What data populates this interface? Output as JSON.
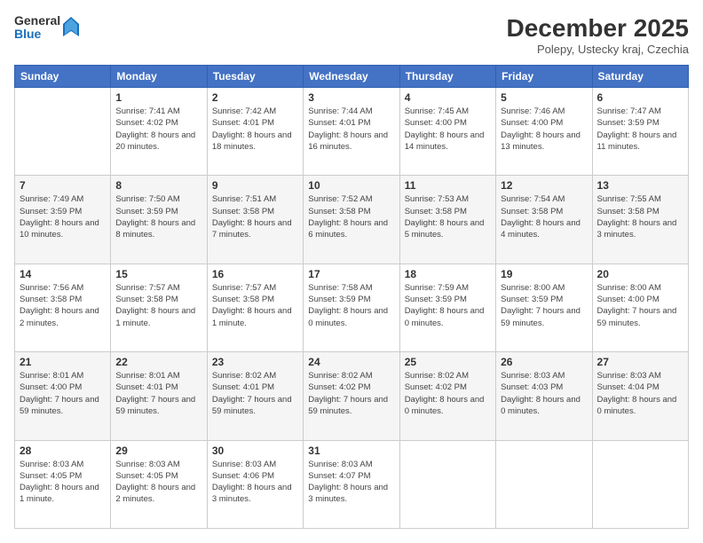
{
  "logo": {
    "general": "General",
    "blue": "Blue"
  },
  "header": {
    "month": "December 2025",
    "location": "Polepy, Ustecky kraj, Czechia"
  },
  "days_of_week": [
    "Sunday",
    "Monday",
    "Tuesday",
    "Wednesday",
    "Thursday",
    "Friday",
    "Saturday"
  ],
  "weeks": [
    [
      {
        "day": "",
        "sunrise": "",
        "sunset": "",
        "daylight": ""
      },
      {
        "day": "1",
        "sunrise": "Sunrise: 7:41 AM",
        "sunset": "Sunset: 4:02 PM",
        "daylight": "Daylight: 8 hours and 20 minutes."
      },
      {
        "day": "2",
        "sunrise": "Sunrise: 7:42 AM",
        "sunset": "Sunset: 4:01 PM",
        "daylight": "Daylight: 8 hours and 18 minutes."
      },
      {
        "day": "3",
        "sunrise": "Sunrise: 7:44 AM",
        "sunset": "Sunset: 4:01 PM",
        "daylight": "Daylight: 8 hours and 16 minutes."
      },
      {
        "day": "4",
        "sunrise": "Sunrise: 7:45 AM",
        "sunset": "Sunset: 4:00 PM",
        "daylight": "Daylight: 8 hours and 14 minutes."
      },
      {
        "day": "5",
        "sunrise": "Sunrise: 7:46 AM",
        "sunset": "Sunset: 4:00 PM",
        "daylight": "Daylight: 8 hours and 13 minutes."
      },
      {
        "day": "6",
        "sunrise": "Sunrise: 7:47 AM",
        "sunset": "Sunset: 3:59 PM",
        "daylight": "Daylight: 8 hours and 11 minutes."
      }
    ],
    [
      {
        "day": "7",
        "sunrise": "Sunrise: 7:49 AM",
        "sunset": "Sunset: 3:59 PM",
        "daylight": "Daylight: 8 hours and 10 minutes."
      },
      {
        "day": "8",
        "sunrise": "Sunrise: 7:50 AM",
        "sunset": "Sunset: 3:59 PM",
        "daylight": "Daylight: 8 hours and 8 minutes."
      },
      {
        "day": "9",
        "sunrise": "Sunrise: 7:51 AM",
        "sunset": "Sunset: 3:58 PM",
        "daylight": "Daylight: 8 hours and 7 minutes."
      },
      {
        "day": "10",
        "sunrise": "Sunrise: 7:52 AM",
        "sunset": "Sunset: 3:58 PM",
        "daylight": "Daylight: 8 hours and 6 minutes."
      },
      {
        "day": "11",
        "sunrise": "Sunrise: 7:53 AM",
        "sunset": "Sunset: 3:58 PM",
        "daylight": "Daylight: 8 hours and 5 minutes."
      },
      {
        "day": "12",
        "sunrise": "Sunrise: 7:54 AM",
        "sunset": "Sunset: 3:58 PM",
        "daylight": "Daylight: 8 hours and 4 minutes."
      },
      {
        "day": "13",
        "sunrise": "Sunrise: 7:55 AM",
        "sunset": "Sunset: 3:58 PM",
        "daylight": "Daylight: 8 hours and 3 minutes."
      }
    ],
    [
      {
        "day": "14",
        "sunrise": "Sunrise: 7:56 AM",
        "sunset": "Sunset: 3:58 PM",
        "daylight": "Daylight: 8 hours and 2 minutes."
      },
      {
        "day": "15",
        "sunrise": "Sunrise: 7:57 AM",
        "sunset": "Sunset: 3:58 PM",
        "daylight": "Daylight: 8 hours and 1 minute."
      },
      {
        "day": "16",
        "sunrise": "Sunrise: 7:57 AM",
        "sunset": "Sunset: 3:58 PM",
        "daylight": "Daylight: 8 hours and 1 minute."
      },
      {
        "day": "17",
        "sunrise": "Sunrise: 7:58 AM",
        "sunset": "Sunset: 3:59 PM",
        "daylight": "Daylight: 8 hours and 0 minutes."
      },
      {
        "day": "18",
        "sunrise": "Sunrise: 7:59 AM",
        "sunset": "Sunset: 3:59 PM",
        "daylight": "Daylight: 8 hours and 0 minutes."
      },
      {
        "day": "19",
        "sunrise": "Sunrise: 8:00 AM",
        "sunset": "Sunset: 3:59 PM",
        "daylight": "Daylight: 7 hours and 59 minutes."
      },
      {
        "day": "20",
        "sunrise": "Sunrise: 8:00 AM",
        "sunset": "Sunset: 4:00 PM",
        "daylight": "Daylight: 7 hours and 59 minutes."
      }
    ],
    [
      {
        "day": "21",
        "sunrise": "Sunrise: 8:01 AM",
        "sunset": "Sunset: 4:00 PM",
        "daylight": "Daylight: 7 hours and 59 minutes."
      },
      {
        "day": "22",
        "sunrise": "Sunrise: 8:01 AM",
        "sunset": "Sunset: 4:01 PM",
        "daylight": "Daylight: 7 hours and 59 minutes."
      },
      {
        "day": "23",
        "sunrise": "Sunrise: 8:02 AM",
        "sunset": "Sunset: 4:01 PM",
        "daylight": "Daylight: 7 hours and 59 minutes."
      },
      {
        "day": "24",
        "sunrise": "Sunrise: 8:02 AM",
        "sunset": "Sunset: 4:02 PM",
        "daylight": "Daylight: 7 hours and 59 minutes."
      },
      {
        "day": "25",
        "sunrise": "Sunrise: 8:02 AM",
        "sunset": "Sunset: 4:02 PM",
        "daylight": "Daylight: 8 hours and 0 minutes."
      },
      {
        "day": "26",
        "sunrise": "Sunrise: 8:03 AM",
        "sunset": "Sunset: 4:03 PM",
        "daylight": "Daylight: 8 hours and 0 minutes."
      },
      {
        "day": "27",
        "sunrise": "Sunrise: 8:03 AM",
        "sunset": "Sunset: 4:04 PM",
        "daylight": "Daylight: 8 hours and 0 minutes."
      }
    ],
    [
      {
        "day": "28",
        "sunrise": "Sunrise: 8:03 AM",
        "sunset": "Sunset: 4:05 PM",
        "daylight": "Daylight: 8 hours and 1 minute."
      },
      {
        "day": "29",
        "sunrise": "Sunrise: 8:03 AM",
        "sunset": "Sunset: 4:05 PM",
        "daylight": "Daylight: 8 hours and 2 minutes."
      },
      {
        "day": "30",
        "sunrise": "Sunrise: 8:03 AM",
        "sunset": "Sunset: 4:06 PM",
        "daylight": "Daylight: 8 hours and 3 minutes."
      },
      {
        "day": "31",
        "sunrise": "Sunrise: 8:03 AM",
        "sunset": "Sunset: 4:07 PM",
        "daylight": "Daylight: 8 hours and 3 minutes."
      },
      {
        "day": "",
        "sunrise": "",
        "sunset": "",
        "daylight": ""
      },
      {
        "day": "",
        "sunrise": "",
        "sunset": "",
        "daylight": ""
      },
      {
        "day": "",
        "sunrise": "",
        "sunset": "",
        "daylight": ""
      }
    ]
  ]
}
